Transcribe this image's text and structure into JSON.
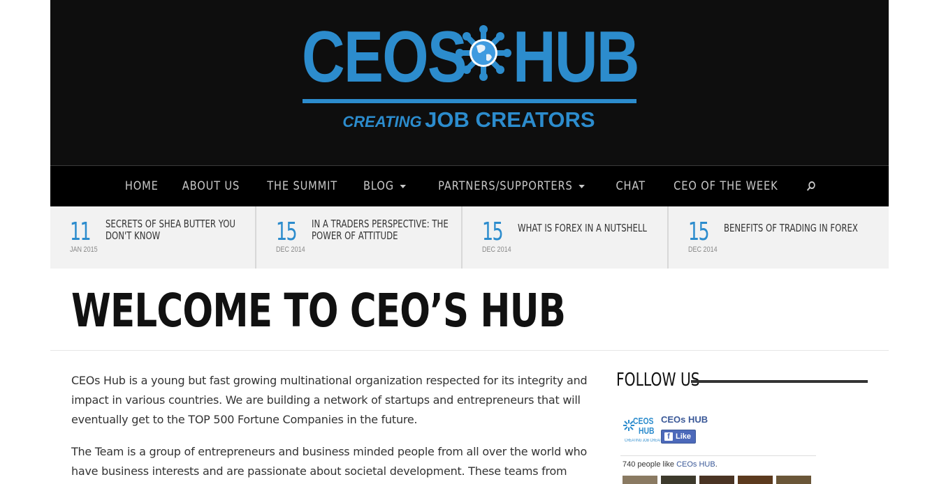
{
  "brand": {
    "logo_left": "CEOS",
    "logo_right": "HUB",
    "tagline_small": "CREATING",
    "tagline_big": "JOB CREATORS",
    "accent_color": "#2c8ccd"
  },
  "nav": {
    "items": [
      {
        "label": "HOME",
        "has_dropdown": false
      },
      {
        "label": "ABOUT US",
        "has_dropdown": false
      },
      {
        "label": "THE SUMMIT",
        "has_dropdown": false
      },
      {
        "label": "BLOG",
        "has_dropdown": true
      },
      {
        "label": "PARTNERS/SUPPORTERS",
        "has_dropdown": true
      },
      {
        "label": "CHAT",
        "has_dropdown": false
      },
      {
        "label": "CEO OF THE WEEK",
        "has_dropdown": false
      }
    ],
    "search_icon": "search-icon"
  },
  "ticker": [
    {
      "day": "11",
      "month": "JAN 2015",
      "title": "SECRETS OF SHEA BUTTER YOU DON'T KNOW"
    },
    {
      "day": "15",
      "month": "DEC 2014",
      "title": "IN A TRADERS PERSPECTIVE: THE POWER OF ATTITUDE"
    },
    {
      "day": "15",
      "month": "DEC 2014",
      "title": "WHAT IS FOREX IN A NUTSHELL"
    },
    {
      "day": "15",
      "month": "DEC 2014",
      "title": "BENEFITS OF TRADING IN FOREX"
    }
  ],
  "page": {
    "title": "WELCOME TO CEO’S HUB",
    "paragraphs": [
      "CEOs Hub is a young but fast growing multinational organization respected for its integrity and impact in various countries. We are building a network of startups and entrepreneurs that will eventually get to the TOP 500 Fortune Companies in the future.",
      "The Team is a group of entrepreneurs and business minded people from all over the world who have business interests and are passionate about societal development. These teams from"
    ]
  },
  "sidebar": {
    "follow_heading": "FOLLOW US",
    "facebook": {
      "logo_line1": "CEOS",
      "logo_line2": "HUB",
      "logo_line3": "CREATING JOB CREATORS",
      "page_name": "CEOs HUB",
      "like_label": "Like",
      "count_text": "740 people like",
      "count_link": "CEOs HUB",
      "count_suffix": "."
    }
  }
}
